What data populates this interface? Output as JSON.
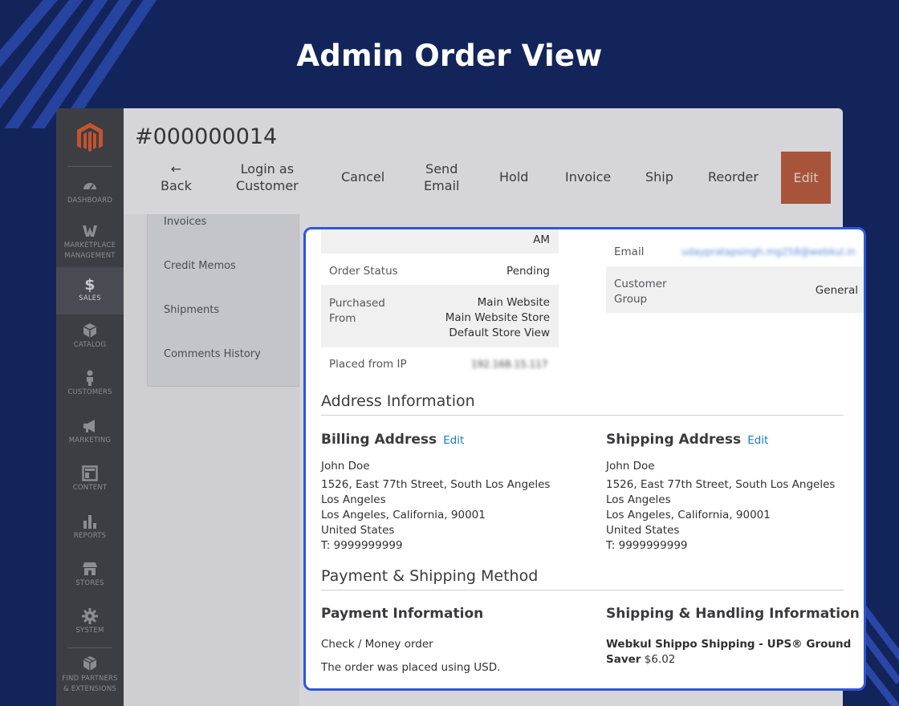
{
  "headline": "Admin Order View",
  "colors": {
    "background": "#12245a",
    "highlight_border": "#2f56d8",
    "edit_button": "#a8543a",
    "link": "#1979c3"
  },
  "sidebar": {
    "logo": "magento-logo-icon",
    "items": [
      {
        "label": "DASHBOARD",
        "icon": "dashboard-icon"
      },
      {
        "label": "MARKETPLACE\nMANAGEMENT",
        "icon": "marketplace-icon"
      },
      {
        "label": "SALES",
        "icon": "dollar-icon",
        "active": true
      },
      {
        "label": "CATALOG",
        "icon": "cube-icon"
      },
      {
        "label": "CUSTOMERS",
        "icon": "person-icon"
      },
      {
        "label": "MARKETING",
        "icon": "megaphone-icon"
      },
      {
        "label": "CONTENT",
        "icon": "layout-icon"
      },
      {
        "label": "REPORTS",
        "icon": "bar-chart-icon"
      },
      {
        "label": "STORES",
        "icon": "store-icon"
      },
      {
        "label": "SYSTEM",
        "icon": "gear-icon"
      },
      {
        "label": "FIND PARTNERS\n& EXTENSIONS",
        "icon": "boxes-icon"
      }
    ]
  },
  "header": {
    "order_number": "#000000014",
    "back_arrow": "←",
    "back": "Back",
    "login_as_1": "Login as",
    "login_as_2": "Customer",
    "cancel": "Cancel",
    "send_1": "Send",
    "send_2": "Email",
    "hold": "Hold",
    "invoice": "Invoice",
    "ship": "Ship",
    "reorder": "Reorder",
    "edit": "Edit"
  },
  "tabs": [
    "Invoices",
    "Credit Memos",
    "Shipments",
    "Comments History"
  ],
  "order_info": {
    "date_tail": "AM",
    "status_label": "Order Status",
    "status_value": "Pending",
    "purchased_label_1": "Purchased",
    "purchased_label_2": "From",
    "purchased_1": "Main Website",
    "purchased_2": "Main Website Store",
    "purchased_3": "Default Store View",
    "ip_label": "Placed from IP",
    "ip_value": "192.168.15.117"
  },
  "account_info": {
    "email_label": "Email",
    "email_value": "udaypratapsingh.mg258@webkul.in",
    "group_label_1": "Customer",
    "group_label_2": "Group",
    "group_value": "General"
  },
  "address_section": {
    "title": "Address Information",
    "billing": {
      "title": "Billing Address",
      "edit": "Edit",
      "name": "John Doe",
      "line1": "1526, East 77th Street, South Los Angeles",
      "line2": "Los Angeles",
      "line3": "Los Angeles, California, 90001",
      "line4": "United States",
      "phone": "T: 9999999999"
    },
    "shipping": {
      "title": "Shipping Address",
      "edit": "Edit",
      "name": "John Doe",
      "line1": "1526, East 77th Street, South Los Angeles",
      "line2": "Los Angeles",
      "line3": "Los Angeles, California, 90001",
      "line4": "United States",
      "phone": "T: 9999999999"
    }
  },
  "payment_section": {
    "title": "Payment & Shipping Method",
    "payment_title": "Payment Information",
    "payment_method": "Check / Money order",
    "payment_note": "The order was placed using USD.",
    "shipping_title": "Shipping & Handling Information",
    "shipping_method_1": "Webkul Shippo Shipping - UPS® Ground",
    "shipping_method_2": "Saver",
    "shipping_price": "$6.02"
  }
}
